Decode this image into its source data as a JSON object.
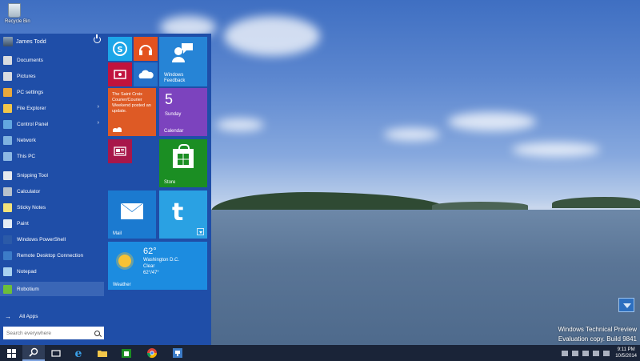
{
  "desktop": {
    "recycle_bin_label": "Recycle Bin",
    "watermark_line1": "Windows Technical Preview",
    "watermark_line2": "Evaluation copy. Build 9841"
  },
  "start_menu": {
    "user_name": "James Todd",
    "items": [
      {
        "label": "Documents",
        "icon": "documents-icon",
        "color": "#d8dbe0"
      },
      {
        "label": "Pictures",
        "icon": "pictures-icon",
        "color": "#d8dbe0"
      },
      {
        "label": "PC settings",
        "icon": "gear-icon",
        "color": "#e9a83b"
      },
      {
        "label": "File Explorer",
        "icon": "folder-icon",
        "color": "#f2c64a",
        "submenu": "›"
      },
      {
        "label": "Control Panel",
        "icon": "control-panel-icon",
        "color": "#62a7e0",
        "submenu": "›"
      },
      {
        "label": "Network",
        "icon": "network-icon",
        "color": "#7fb2e0"
      },
      {
        "label": "This PC",
        "icon": "computer-icon",
        "color": "#8cb8e4"
      },
      {
        "label": "Snipping Tool",
        "icon": "scissors-icon",
        "color": "#e6e9ee"
      },
      {
        "label": "Calculator",
        "icon": "calculator-icon",
        "color": "#b8c2cc"
      },
      {
        "label": "Sticky Notes",
        "icon": "sticky-notes-icon",
        "color": "#f3e27a"
      },
      {
        "label": "Paint",
        "icon": "paint-icon",
        "color": "#e6eef5"
      },
      {
        "label": "Windows PowerShell",
        "icon": "powershell-icon",
        "color": "#2b5aa8"
      },
      {
        "label": "Remote Desktop Connection",
        "icon": "remote-desktop-icon",
        "color": "#3c7cc8"
      },
      {
        "label": "Notepad",
        "icon": "notepad-icon",
        "color": "#a9d2f0"
      },
      {
        "label": "Robotium",
        "icon": "robot-icon",
        "color": "#6cbf3a"
      }
    ],
    "all_apps_label": "All Apps",
    "search_placeholder": "Search everywhere"
  },
  "tiles": {
    "feedback": "Windows Feedback",
    "people_text": "The Saint Croix Courier/Courier Weekend posted an update.",
    "calendar_day": "5",
    "calendar_weekday": "Sunday",
    "calendar_label": "Calendar",
    "store_label": "Store",
    "mail_label": "Mail",
    "weather_temp": "62°",
    "weather_city": "Washington D.C.",
    "weather_condition": "Clear",
    "weather_range": "62°/47°",
    "weather_label": "Weather"
  },
  "taskbar": {
    "clock_time": "9:11 PM",
    "clock_date": "10/5/2014"
  },
  "colors": {
    "accent": "#1f4ea8",
    "taskbar": "#1a2438"
  }
}
